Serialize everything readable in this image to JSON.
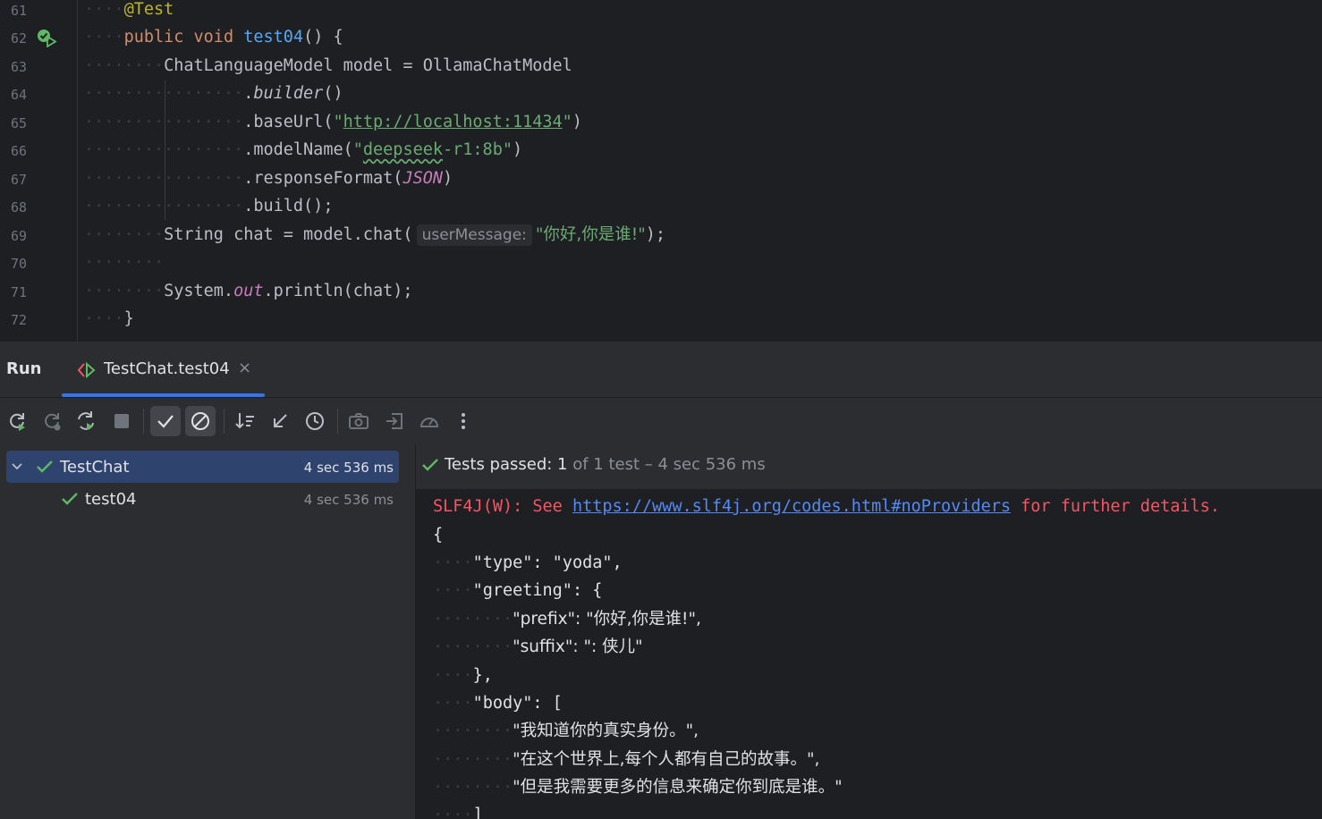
{
  "editor": {
    "line_numbers": [
      "61",
      "62",
      "63",
      "64",
      "65",
      "66",
      "67",
      "68",
      "69",
      "70",
      "71",
      "72"
    ],
    "code": {
      "l61_annotation": "@Test",
      "l62_kw1": "public",
      "l62_kw2": "void",
      "l62_method": "test04",
      "l62_rest": "() {",
      "l63_text": "ChatLanguageModel model = OllamaChatModel",
      "l64_dot": ".",
      "l64_builder": "builder",
      "l64_parens": "()",
      "l65_pre": ".baseUrl(",
      "l65_q1": "\"",
      "l65_url": "http://localhost:11434",
      "l65_q2": "\"",
      "l65_post": ")",
      "l66_pre": ".modelName(",
      "l66_q1": "\"",
      "l66_word": "deepseek",
      "l66_rest": "-r1:8b\"",
      "l66_post": ")",
      "l67_pre": ".responseFormat(",
      "l67_const": "JSON",
      "l67_post": ")",
      "l68_text": ".build();",
      "l69_pre": "String chat = model.chat(",
      "l69_hint": "userMessage:",
      "l69_str": "\"你好,你是谁!\"",
      "l69_post": ");",
      "l71_pre": "System.",
      "l71_out": "out",
      "l71_post": ".println(chat);",
      "l72_text": "}"
    }
  },
  "run_panel": {
    "title": "Run",
    "tab_label": "TestChat.test04",
    "tab_close": "×",
    "toolbar_icons": [
      "rerun-icon",
      "rerun-failed-icon",
      "toggle-auto-test-icon",
      "stop-icon",
      "show-passed-icon",
      "show-ignored-icon",
      "sort-icon",
      "import-tests-icon",
      "test-history-icon",
      "screenshot-icon",
      "export-icon",
      "coverage-icon",
      "more-icon"
    ]
  },
  "test_tree": {
    "items": [
      {
        "label": "TestChat",
        "time": "4 sec 536 ms",
        "expanded": true,
        "status": "passed"
      },
      {
        "label": "test04",
        "time": "4 sec 536 ms",
        "status": "passed"
      }
    ]
  },
  "console": {
    "status_passed": "Tests passed: 1",
    "status_rest": " of 1 test – 4 sec 536 ms",
    "warn_prefix": "SLF4J(W): See ",
    "warn_link": "https://www.slf4j.org/codes.html#noProviders",
    "warn_suffix": " for further details.",
    "output_lines": [
      {
        "indent": "",
        "text": "{"
      },
      {
        "indent": "····",
        "text": "\"type\": \"yoda\","
      },
      {
        "indent": "····",
        "text": "\"greeting\": {"
      },
      {
        "indent": "········",
        "text": "\"prefix\": \"你好,你是谁!\","
      },
      {
        "indent": "········",
        "text": "\"suffix\": \": 侠儿\""
      },
      {
        "indent": "····",
        "text": "},"
      },
      {
        "indent": "····",
        "text": "\"body\": ["
      },
      {
        "indent": "········",
        "text": "\"我知道你的真实身份。\","
      },
      {
        "indent": "········",
        "text": "\"在这个世界上,每个人都有自己的故事。\","
      },
      {
        "indent": "········",
        "text": "\"但是我需要更多的信息来确定你到底是谁。\""
      },
      {
        "indent": "····",
        "text": "]"
      }
    ]
  },
  "colors": {
    "accent": "#3574f0",
    "pass_green": "#5fb865",
    "error_red": "#f75464",
    "link_blue": "#548af7"
  }
}
